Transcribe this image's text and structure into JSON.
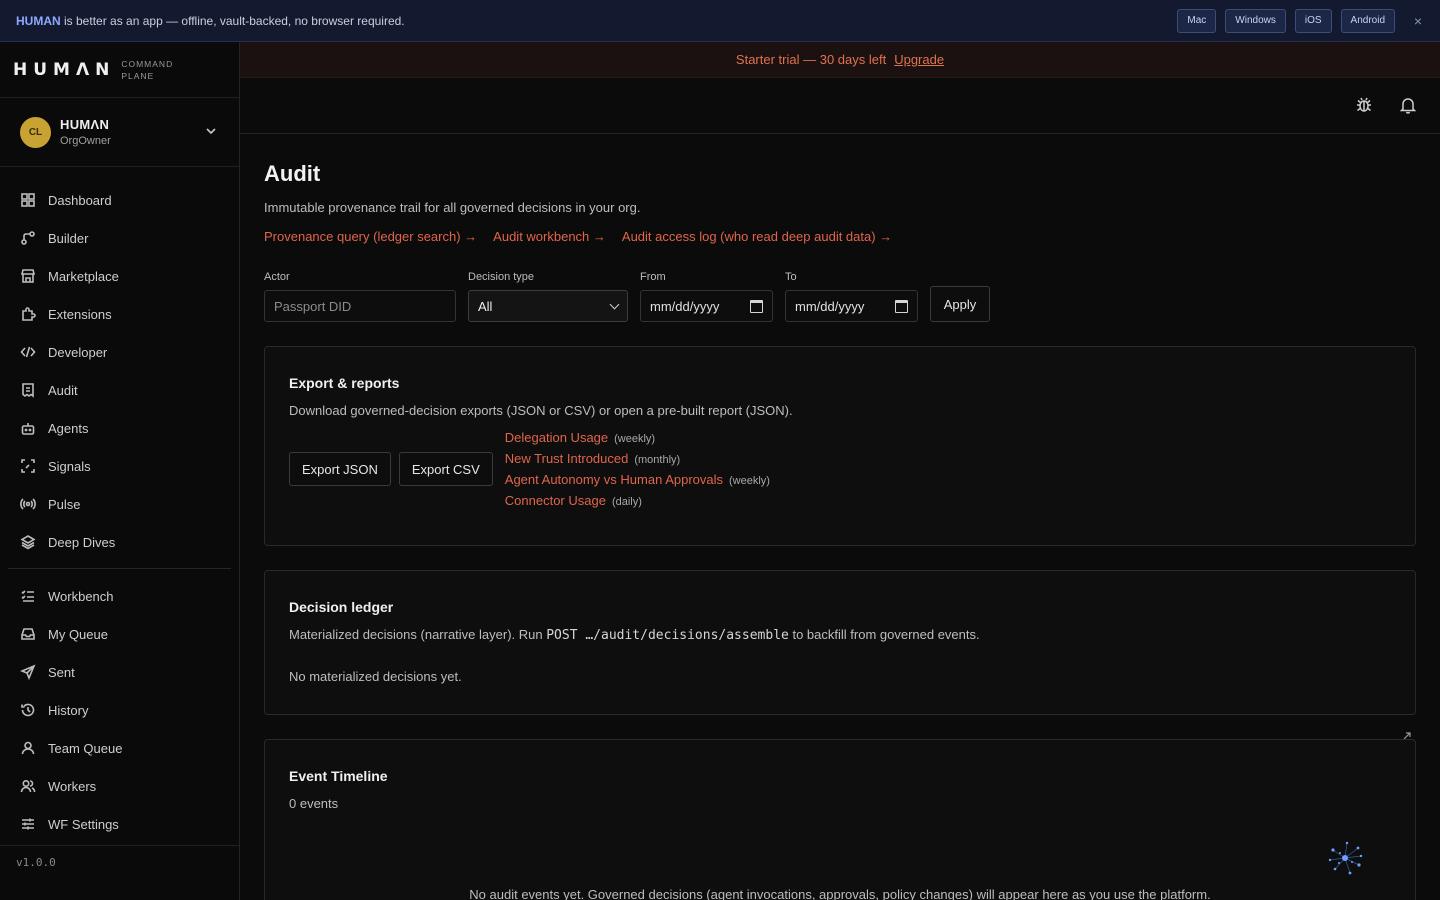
{
  "banner": {
    "brand": "HUMAN",
    "message": " is better as an app — offline, vault-backed, no browser required.",
    "platforms": [
      "Mac",
      "Windows",
      "iOS",
      "Android"
    ],
    "close": "×"
  },
  "sidebar": {
    "logo": "HUMΛN",
    "logo_sub_1": "COMMAND",
    "logo_sub_2": "PLANE",
    "org": {
      "initials": "CL",
      "name": "HUMΛN",
      "role": "OrgOwner"
    },
    "items_primary": [
      {
        "label": "Dashboard",
        "icon": "dashboard-icon"
      },
      {
        "label": "Builder",
        "icon": "builder-icon"
      },
      {
        "label": "Marketplace",
        "icon": "store-icon"
      },
      {
        "label": "Extensions",
        "icon": "puzzle-icon"
      },
      {
        "label": "Developer",
        "icon": "code-icon"
      },
      {
        "label": "Audit",
        "icon": "receipt-icon"
      },
      {
        "label": "Agents",
        "icon": "bot-icon"
      },
      {
        "label": "Signals",
        "icon": "scan-icon"
      },
      {
        "label": "Pulse",
        "icon": "radio-icon"
      },
      {
        "label": "Deep Dives",
        "icon": "layers-icon"
      }
    ],
    "items_secondary": [
      {
        "label": "Workbench",
        "icon": "checklist-icon"
      },
      {
        "label": "My Queue",
        "icon": "inbox-icon"
      },
      {
        "label": "Sent",
        "icon": "send-icon"
      },
      {
        "label": "History",
        "icon": "history-icon"
      },
      {
        "label": "Team Queue",
        "icon": "user-icon"
      },
      {
        "label": "Workers",
        "icon": "users-icon"
      },
      {
        "label": "WF Settings",
        "icon": "sliders-icon"
      }
    ],
    "version": "v1.0.0"
  },
  "trial": {
    "text": "Starter trial — 30 days left",
    "upgrade": "Upgrade"
  },
  "page": {
    "title": "Audit",
    "subtitle": "Immutable provenance trail for all governed decisions in your org.",
    "links": [
      "Provenance query (ledger search) →",
      "Audit workbench →",
      "Audit access log (who read deep audit data) →"
    ]
  },
  "filters": {
    "actor_label": "Actor",
    "actor_placeholder": "Passport DID",
    "type_label": "Decision type",
    "type_value": "All",
    "from_label": "From",
    "from_value": "mm/dd/yyyy",
    "to_label": "To",
    "to_value": "mm/dd/yyyy",
    "apply": "Apply"
  },
  "export": {
    "title": "Export & reports",
    "desc": "Download governed-decision exports (JSON or CSV) or open a pre-built report (JSON).",
    "json_btn": "Export JSON",
    "csv_btn": "Export CSV",
    "reports": [
      {
        "name": "Delegation Usage",
        "freq": "(weekly)"
      },
      {
        "name": "New Trust Introduced",
        "freq": "(monthly)"
      },
      {
        "name": "Agent Autonomy vs Human Approvals",
        "freq": "(weekly)"
      },
      {
        "name": "Connector Usage",
        "freq": "(daily)"
      }
    ]
  },
  "ledger": {
    "title": "Decision ledger",
    "desc_pre": "Materialized decisions (narrative layer). Run ",
    "desc_code": "POST …/audit/decisions/assemble",
    "desc_post": " to backfill from governed events.",
    "empty": "No materialized decisions yet."
  },
  "timeline": {
    "title": "Event Timeline",
    "count": "0 events",
    "empty": "No audit events yet. Governed decisions (agent invocations, approvals, policy changes) will appear here as you use the platform."
  }
}
